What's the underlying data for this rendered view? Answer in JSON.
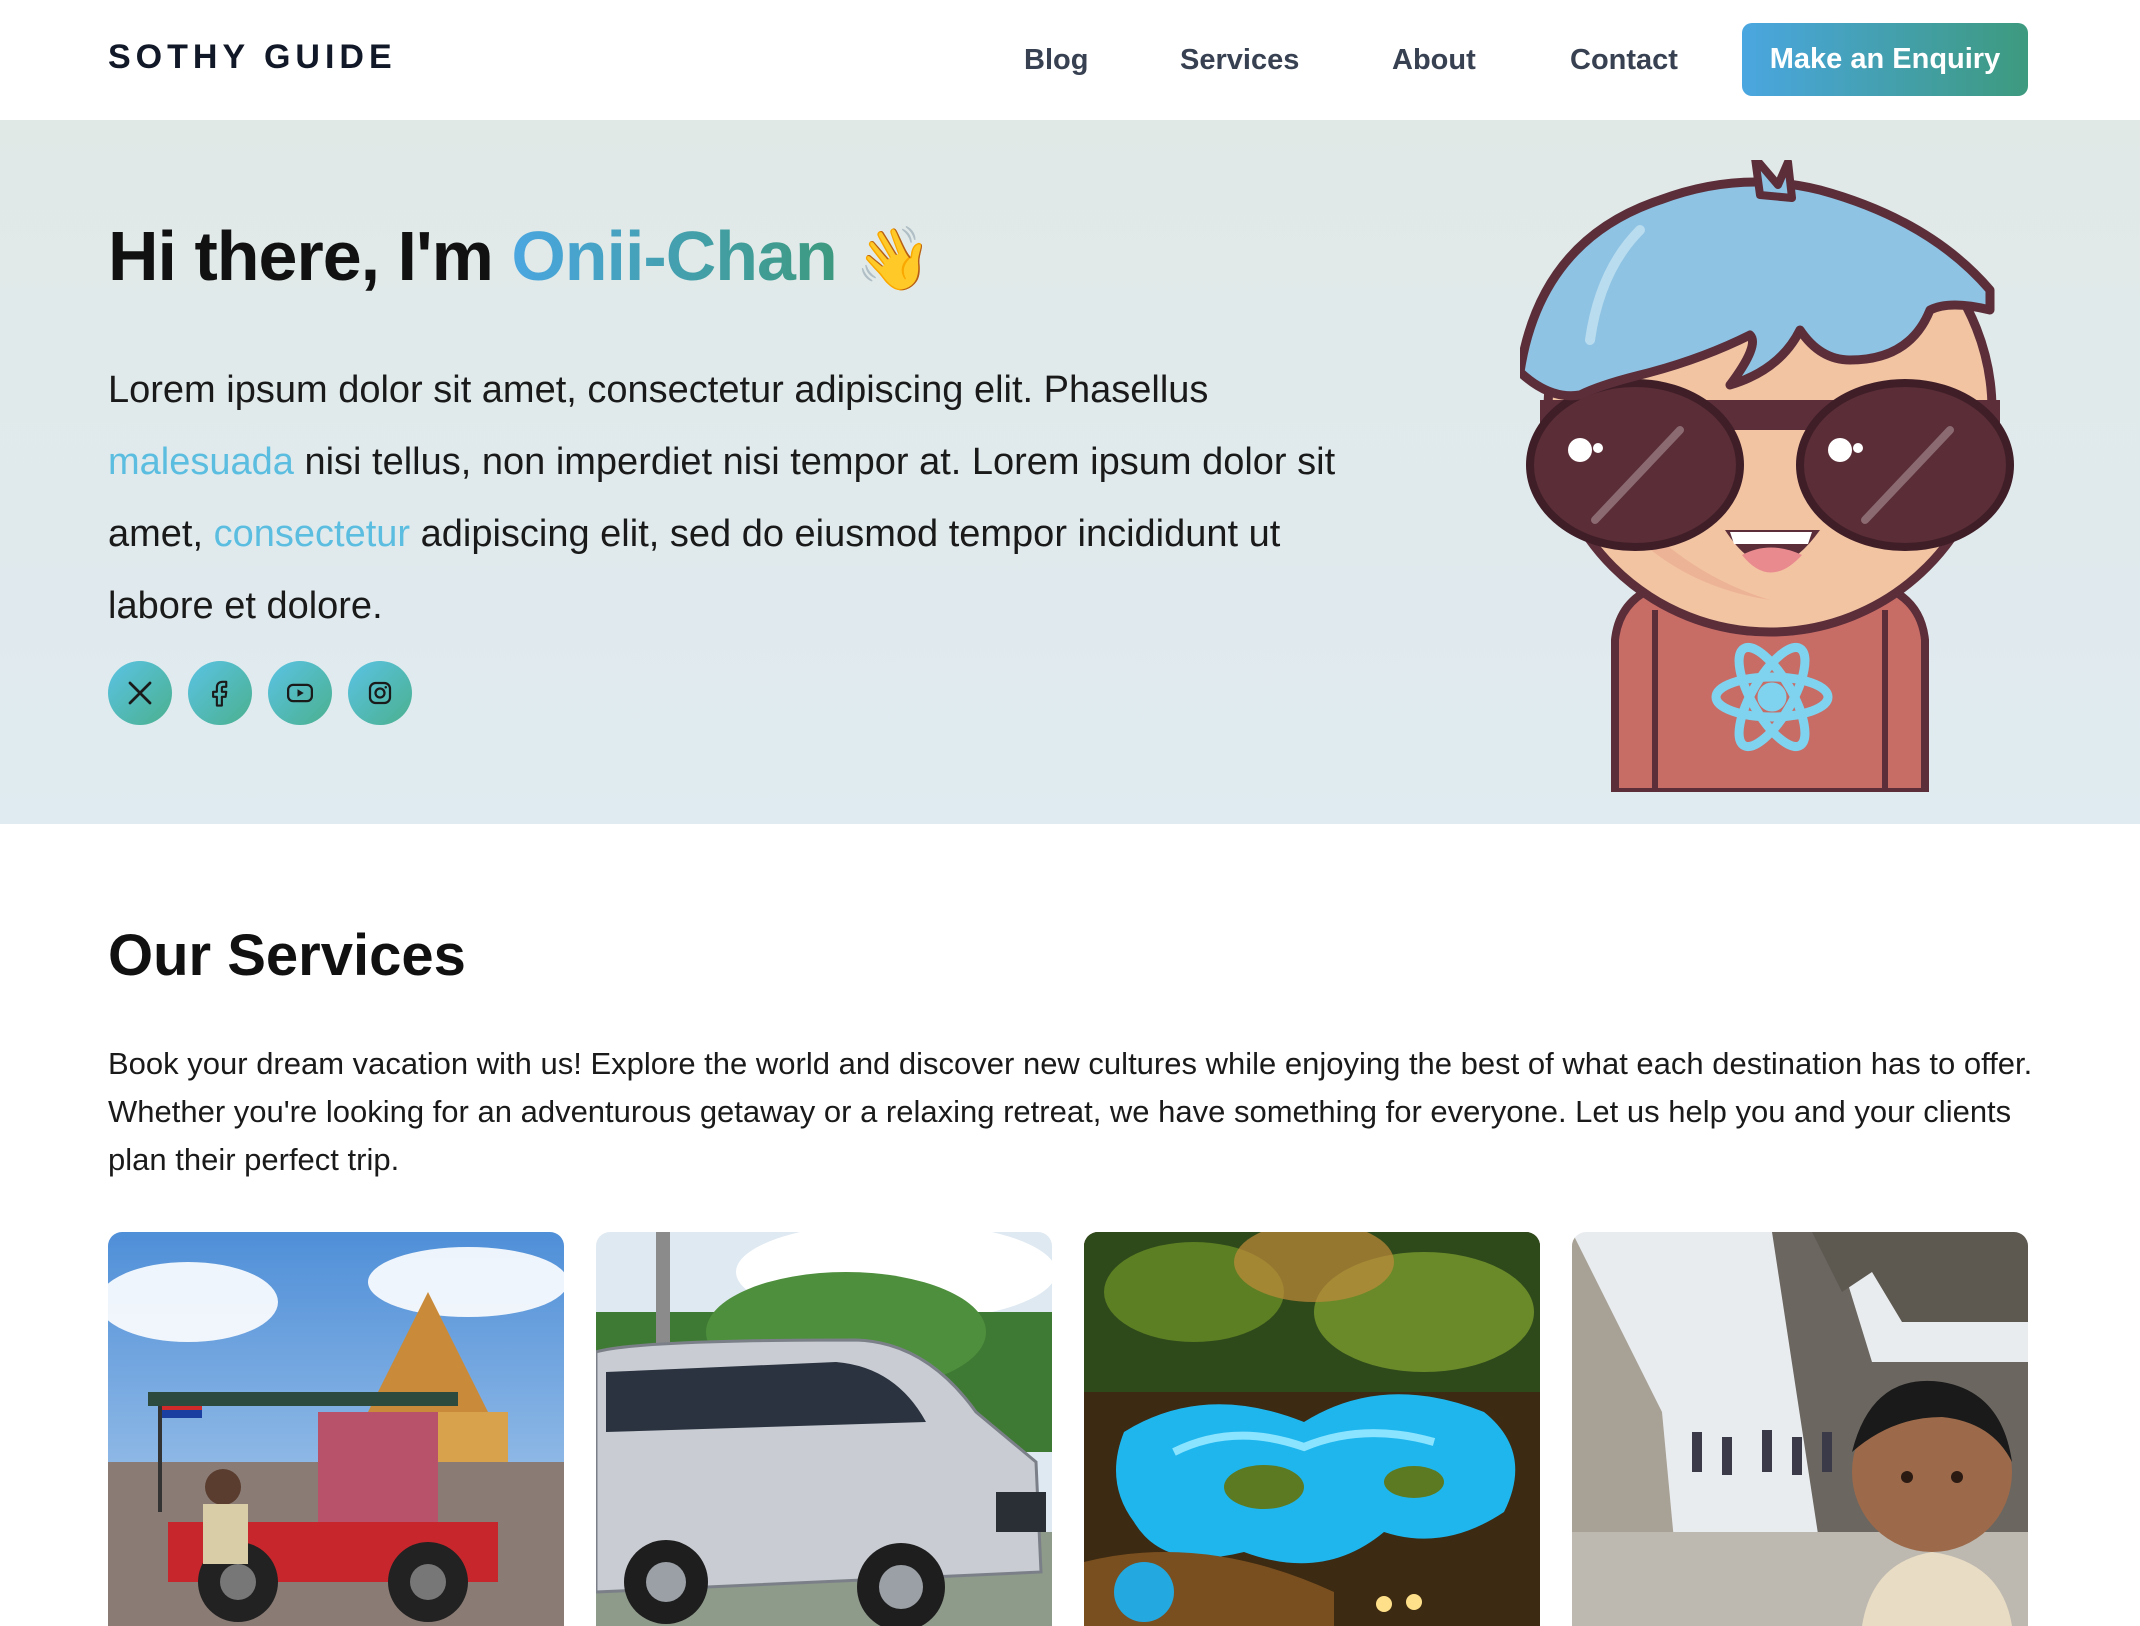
{
  "header": {
    "brand": "SOTHY GUIDE",
    "nav": [
      "Blog",
      "Services",
      "About",
      "Contact"
    ],
    "cta": "Make an Enquiry"
  },
  "hero": {
    "greeting": "Hi there, I'm ",
    "name": "Onii-Chan",
    "emoji": "👋",
    "p1": "Lorem ipsum dolor sit amet, consectetur adipiscing elit. Phasellus ",
    "link1": "malesuada",
    "p2": " nisi tellus, non imperdiet nisi tempor at. Lorem ipsum dolor sit amet, ",
    "link2": "consectetur",
    "p3": " adipiscing elit, sed do eiusmod tempor incididunt ut labore et dolore.",
    "social_icons": [
      "x-icon",
      "facebook-icon",
      "youtube-icon",
      "instagram-icon"
    ]
  },
  "services": {
    "title": "Our Services",
    "description": "Book your dream vacation with us! Explore the world and discover new cultures while enjoying the best of what each destination has to offer. Whether you're looking for an adventurous getaway or a relaxing retreat, we have something for everyone. Let us help you and your clients plan their perfect trip.",
    "cards": [
      {
        "image": "tuk-tuk-photo"
      },
      {
        "image": "minivan-photo"
      },
      {
        "image": "resort-pool-photo"
      },
      {
        "image": "temple-guide-photo"
      }
    ]
  },
  "colors": {
    "accent_start": "#4aa6e0",
    "accent_end": "#3d9a7e",
    "link": "#5bbde0",
    "hero_bg": "#e1e9ea"
  }
}
